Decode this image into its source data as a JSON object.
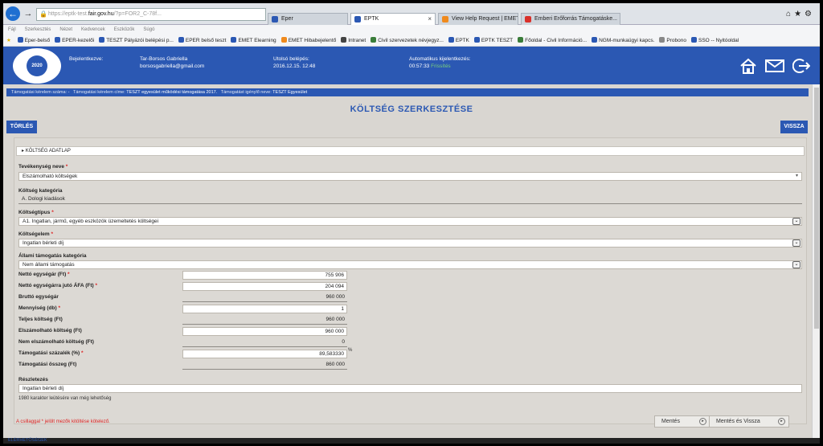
{
  "browser": {
    "url_prefix": "https://eptk-test.",
    "url_domain": "fair.gov.hu",
    "url_rest": "/?p=FOR2_C-78f... ",
    "tabs": [
      {
        "label": "Eper",
        "color": "#2b58b3"
      },
      {
        "label": "EPTK",
        "color": "#2b58b3"
      },
      {
        "label": "View Help Request | EMET IT H...",
        "color": "#f08a1c"
      },
      {
        "label": "Emberi Erőforrás Támogatáske...",
        "color": "#d9302a"
      }
    ],
    "menu": [
      "Fájl",
      "Szerkesztés",
      "Nézet",
      "Kedvencek",
      "Eszközök",
      "Súgó"
    ],
    "favorites": [
      {
        "label": "Eper-belső",
        "color": "#2b58b3"
      },
      {
        "label": "EPER-kezelői",
        "color": "#2b58b3"
      },
      {
        "label": "TESZT Pályázói belépési p...",
        "color": "#2b58b3"
      },
      {
        "label": "EPER belső teszt",
        "color": "#2b58b3"
      },
      {
        "label": "EMET Elearning",
        "color": "#2b58b3"
      },
      {
        "label": "EMET Hibabejelentő",
        "color": "#f08a1c"
      },
      {
        "label": "Intranet",
        "color": "#444"
      },
      {
        "label": "Civil szervezetek névjegyz...",
        "color": "#3a7d3a"
      },
      {
        "label": "EPTK",
        "color": "#2b58b3"
      },
      {
        "label": "EPTK TESZT",
        "color": "#2b58b3"
      },
      {
        "label": "Főoldal - Civil Információ...",
        "color": "#3a7d3a"
      },
      {
        "label": "NGM-munkaügyi kapcs.",
        "color": "#2b58b3"
      },
      {
        "label": "Probono",
        "color": "#888"
      },
      {
        "label": "SSO -- Nyitóoldal",
        "color": "#2b58b3"
      }
    ]
  },
  "header": {
    "logo_text": "2020",
    "logged_in_label": "Bejelentkezve:",
    "user_name": "Tar-Borsos Gabriella",
    "user_email": "borsosgabriella@gmail.com",
    "last_login_label": "Utolsó belépés:",
    "last_login_value": "2016.12.15. 12:48",
    "auto_logout_label": "Automatikus kijelentkezés:",
    "auto_logout_value": "00:57:33",
    "auto_logout_extra": "Frissítés"
  },
  "breadcrumb": {
    "k1": "Támogatási kérelem száma:",
    "v1": "-",
    "k2": "Támogatási kérelem címe:",
    "v2": "TESZT egyesület működési támogatása 2017.",
    "k3": "Támogatást igénylő neve:",
    "v3": "TESZT Egyesület"
  },
  "page": {
    "title": "KÖLTSÉG SZERKESZTÉSE",
    "delete_label": "TÖRLÉS",
    "back_label": "VISSZA",
    "section_label": "KÖLTSÉG ADATLAP"
  },
  "form": {
    "activity_label": "Tevékenység neve",
    "activity_value": "Elszámolható költségek",
    "cost_category_label": "Költség kategória",
    "cost_category_value": "A. Dologi kiadások",
    "cost_type_label": "Költségtípus",
    "cost_type_value": "A1. Ingatlan, jármű, egyéb eszközök üzemeltetés költségei",
    "cost_item_label": "Költségelem",
    "cost_item_value": "Ingatlan bérleti díj",
    "state_aid_label": "Állami támogatás kategória",
    "state_aid_value": "Nem állami támogatás",
    "rows": [
      {
        "label": "Nettó egységár (Ft)",
        "value": "755 906",
        "required": true,
        "editable": true
      },
      {
        "label": "Nettó egységárra jutó ÁFA (Ft)",
        "value": "204 094",
        "required": true,
        "editable": true
      },
      {
        "label": "Bruttó egységár",
        "value": "960 000",
        "required": false,
        "editable": false
      },
      {
        "label": "Mennyiség (db)",
        "value": "1",
        "required": true,
        "editable": true
      },
      {
        "label": "Teljes költség (Ft)",
        "value": "960 000",
        "required": false,
        "editable": false
      },
      {
        "label": "Elszámolható költség (Ft)",
        "value": "960 000",
        "required": false,
        "editable": true
      },
      {
        "label": "Nem elszámolható költség (Ft)",
        "value": "0",
        "required": false,
        "editable": false
      },
      {
        "label": "Támogatási százalék (%)",
        "value": "89,583330",
        "required": true,
        "editable": true
      },
      {
        "label": "Támogatási összeg (Ft)",
        "value": "860 000",
        "required": false,
        "editable": false
      }
    ],
    "percent_sign": "%",
    "details_label": "Részletezés",
    "details_value": "Ingatlan bérleti díj",
    "chars_left": "1980 karakter leütésére van még lehetőség",
    "required_note": "A csillaggal * jelölt mezők kitöltése kötelező.",
    "save_label": "Mentés",
    "save_back_label": "Mentés és Vissza"
  },
  "footer": {
    "text": "ELÉRHETŐSÉGEK"
  }
}
